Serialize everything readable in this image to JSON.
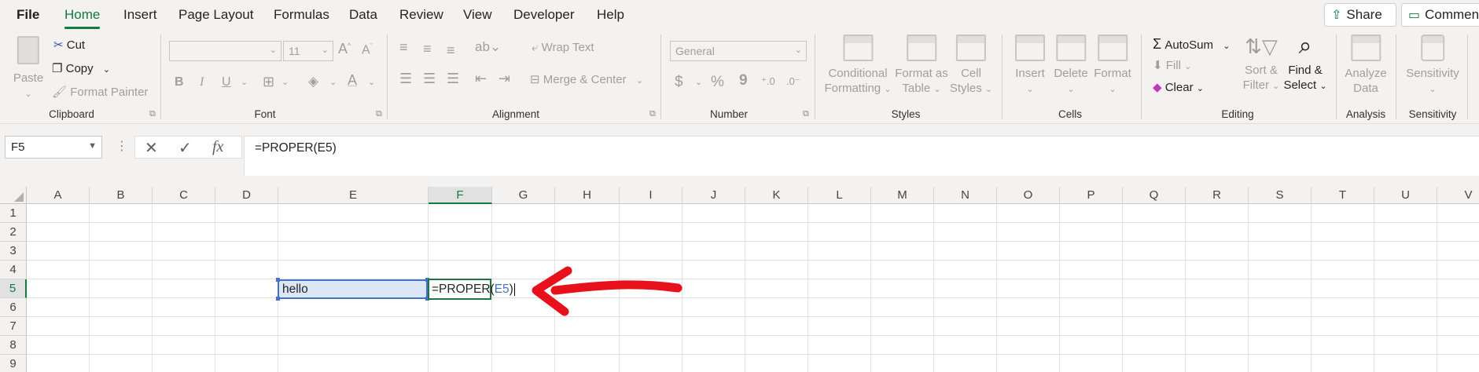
{
  "menu": {
    "tabs": [
      "File",
      "Home",
      "Insert",
      "Page Layout",
      "Formulas",
      "Data",
      "Review",
      "View",
      "Developer",
      "Help"
    ],
    "active": "Home",
    "share_label": "Share",
    "comments_label": "Comments"
  },
  "ribbon": {
    "clipboard": {
      "label": "Clipboard",
      "paste": "Paste",
      "cut": "Cut",
      "copy": "Copy",
      "format_painter": "Format Painter"
    },
    "font": {
      "label": "Font",
      "size": "11",
      "bold": "B",
      "italic": "I",
      "underline": "U"
    },
    "alignment": {
      "label": "Alignment",
      "wrap_text": "Wrap Text",
      "merge_center": "Merge & Center"
    },
    "number": {
      "label": "Number",
      "format": "General",
      "currency": "$",
      "percent": "%",
      "comma": "9"
    },
    "styles": {
      "label": "Styles",
      "conditional_1": "Conditional",
      "conditional_2": "Formatting",
      "format_table_1": "Format as",
      "format_table_2": "Table",
      "cell_styles_1": "Cell",
      "cell_styles_2": "Styles"
    },
    "cells": {
      "label": "Cells",
      "insert": "Insert",
      "delete": "Delete",
      "format": "Format"
    },
    "editing": {
      "label": "Editing",
      "autosum": "AutoSum",
      "fill": "Fill",
      "clear": "Clear",
      "sort_1": "Sort &",
      "sort_2": "Filter",
      "find_1": "Find &",
      "find_2": "Select"
    },
    "analysis": {
      "label": "Analysis",
      "analyze_1": "Analyze",
      "analyze_2": "Data"
    },
    "sensitivity": {
      "label": "Sensitivity",
      "button": "Sensitivity"
    }
  },
  "formula_bar": {
    "name_box": "F5",
    "formula": "=PROPER(E5)"
  },
  "grid": {
    "columns": [
      "A",
      "B",
      "C",
      "D",
      "E",
      "F",
      "G",
      "H",
      "I",
      "J",
      "K",
      "L",
      "M",
      "N",
      "O",
      "P",
      "Q",
      "R",
      "S",
      "T",
      "U",
      "V"
    ],
    "rows": [
      "1",
      "2",
      "3",
      "4",
      "5",
      "6",
      "7",
      "8",
      "9"
    ],
    "selected_column": "F",
    "selected_row": "5",
    "cells": {
      "E5": "hello",
      "F5_prefix": "=PROPER(",
      "F5_ref": "E5",
      "F5_suffix": ")"
    }
  },
  "colors": {
    "accent": "#107c41",
    "reference": "#4472c4",
    "annotation": "#e8101a"
  }
}
